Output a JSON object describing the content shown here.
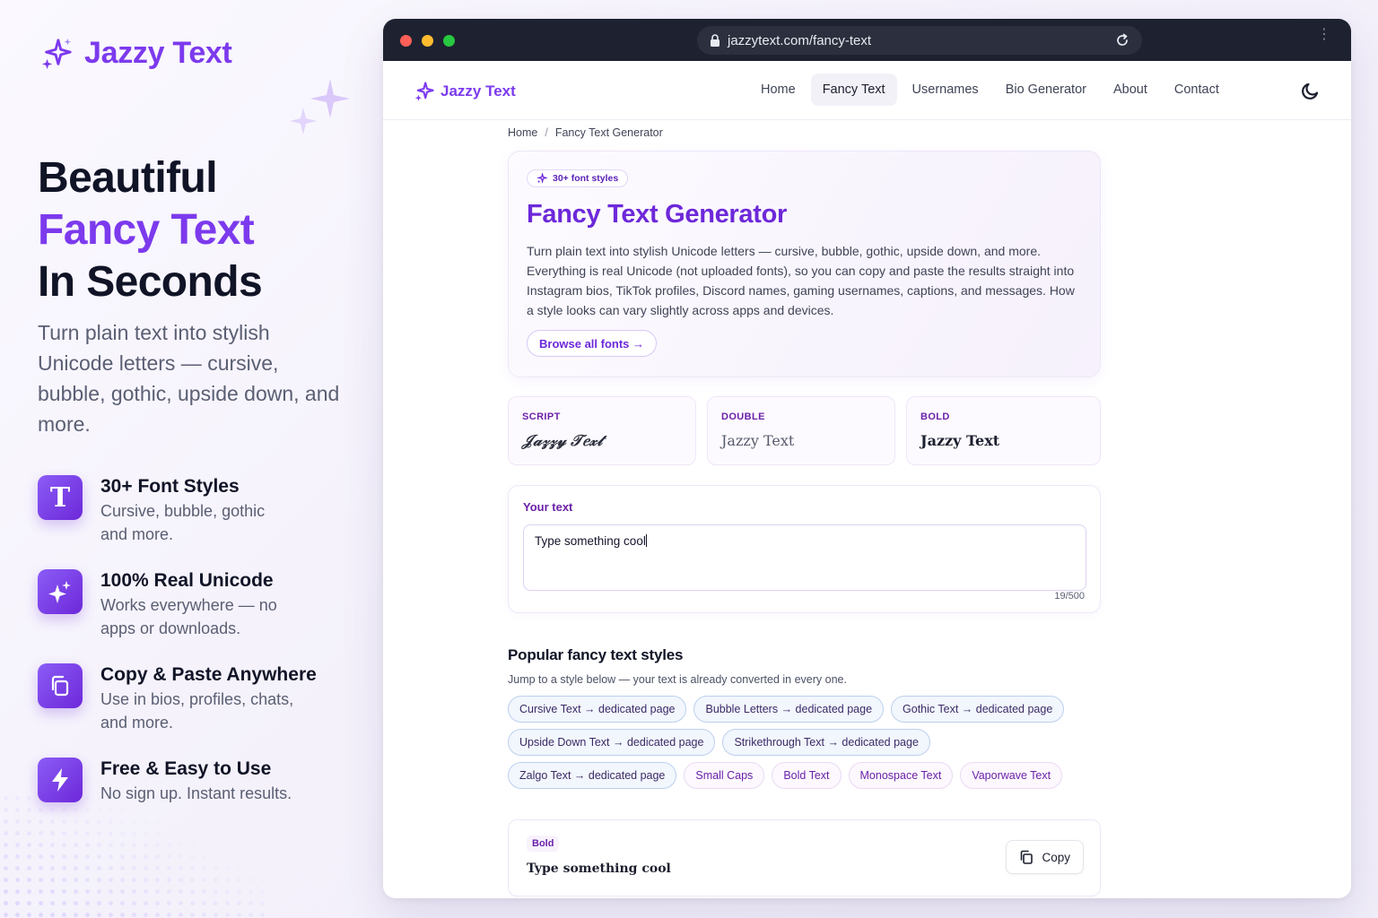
{
  "brand": {
    "name": "Jazzy Text",
    "accent": "#7c3aed"
  },
  "hero": {
    "line1": "Beautiful",
    "line2": "Fancy Text",
    "line3": "In Seconds",
    "subtitle": "Turn plain text into stylish Unicode letters — cursive, bubble, gothic, upside down, and more."
  },
  "features": [
    {
      "icon": "letter-t-icon",
      "title": "30+ Font Styles",
      "desc": "Cursive, bubble, gothic and more."
    },
    {
      "icon": "sparkle-icon",
      "title": "100% Real Unicode",
      "desc": "Works everywhere — no apps or downloads."
    },
    {
      "icon": "copy-icon",
      "title": "Copy & Paste Anywhere",
      "desc": "Use in bios, profiles, chats, and more."
    },
    {
      "icon": "lightning-icon",
      "title": "Free & Easy to Use",
      "desc": "No sign up. Instant results."
    }
  ],
  "browser": {
    "url": "jazzytext.com/fancy-text"
  },
  "nav": {
    "logo": "Jazzy Text",
    "links": [
      "Home",
      "Fancy Text",
      "Usernames",
      "Bio Generator",
      "About",
      "Contact"
    ],
    "active": "Fancy Text"
  },
  "breadcrumb": {
    "home": "Home",
    "separator": "/",
    "current": "Fancy Text Generator"
  },
  "hero_card": {
    "badge": "30+ font styles",
    "title": "Fancy Text Generator",
    "description": "Turn plain text into stylish Unicode letters — cursive, bubble, gothic, upside down, and more. Everything is real Unicode (not uploaded fonts), so you can copy and paste the results straight into Instagram bios, TikTok profiles, Discord names, gaming usernames, captions, and messages. How a style looks can vary slightly across apps and devices.",
    "button": "Browse all fonts →"
  },
  "style_previews": [
    {
      "label": "SCRIPT",
      "sample": "𝒥𝒶𝓏𝓏𝓎 𝒯𝑒𝓍𝓉"
    },
    {
      "label": "DOUBLE",
      "sample": "Jazzy Text"
    },
    {
      "label": "BOLD",
      "sample": "Jazzy Text"
    }
  ],
  "input": {
    "label": "Your text",
    "value": "Type something cool",
    "counter": "19/500"
  },
  "popular": {
    "title": "Popular fancy text styles",
    "subtitle": "Jump to a style below — your text is already converted in every one.",
    "pills": [
      {
        "label": "Cursive Text → dedicated page",
        "kind": "link"
      },
      {
        "label": "Bubble Letters → dedicated page",
        "kind": "link"
      },
      {
        "label": "Gothic Text → dedicated page",
        "kind": "link"
      },
      {
        "label": "Upside Down Text → dedicated page",
        "kind": "link"
      },
      {
        "label": "Strikethrough Text → dedicated page",
        "kind": "link"
      },
      {
        "label": "Zalgo Text → dedicated page",
        "kind": "link"
      },
      {
        "label": "Small Caps",
        "kind": "plain"
      },
      {
        "label": "Bold Text",
        "kind": "plain"
      },
      {
        "label": "Monospace Text",
        "kind": "plain"
      },
      {
        "label": "Vaporwave Text",
        "kind": "plain"
      }
    ]
  },
  "result": {
    "tag": "Bold",
    "text": "Type something cool",
    "copy_label": "Copy"
  }
}
